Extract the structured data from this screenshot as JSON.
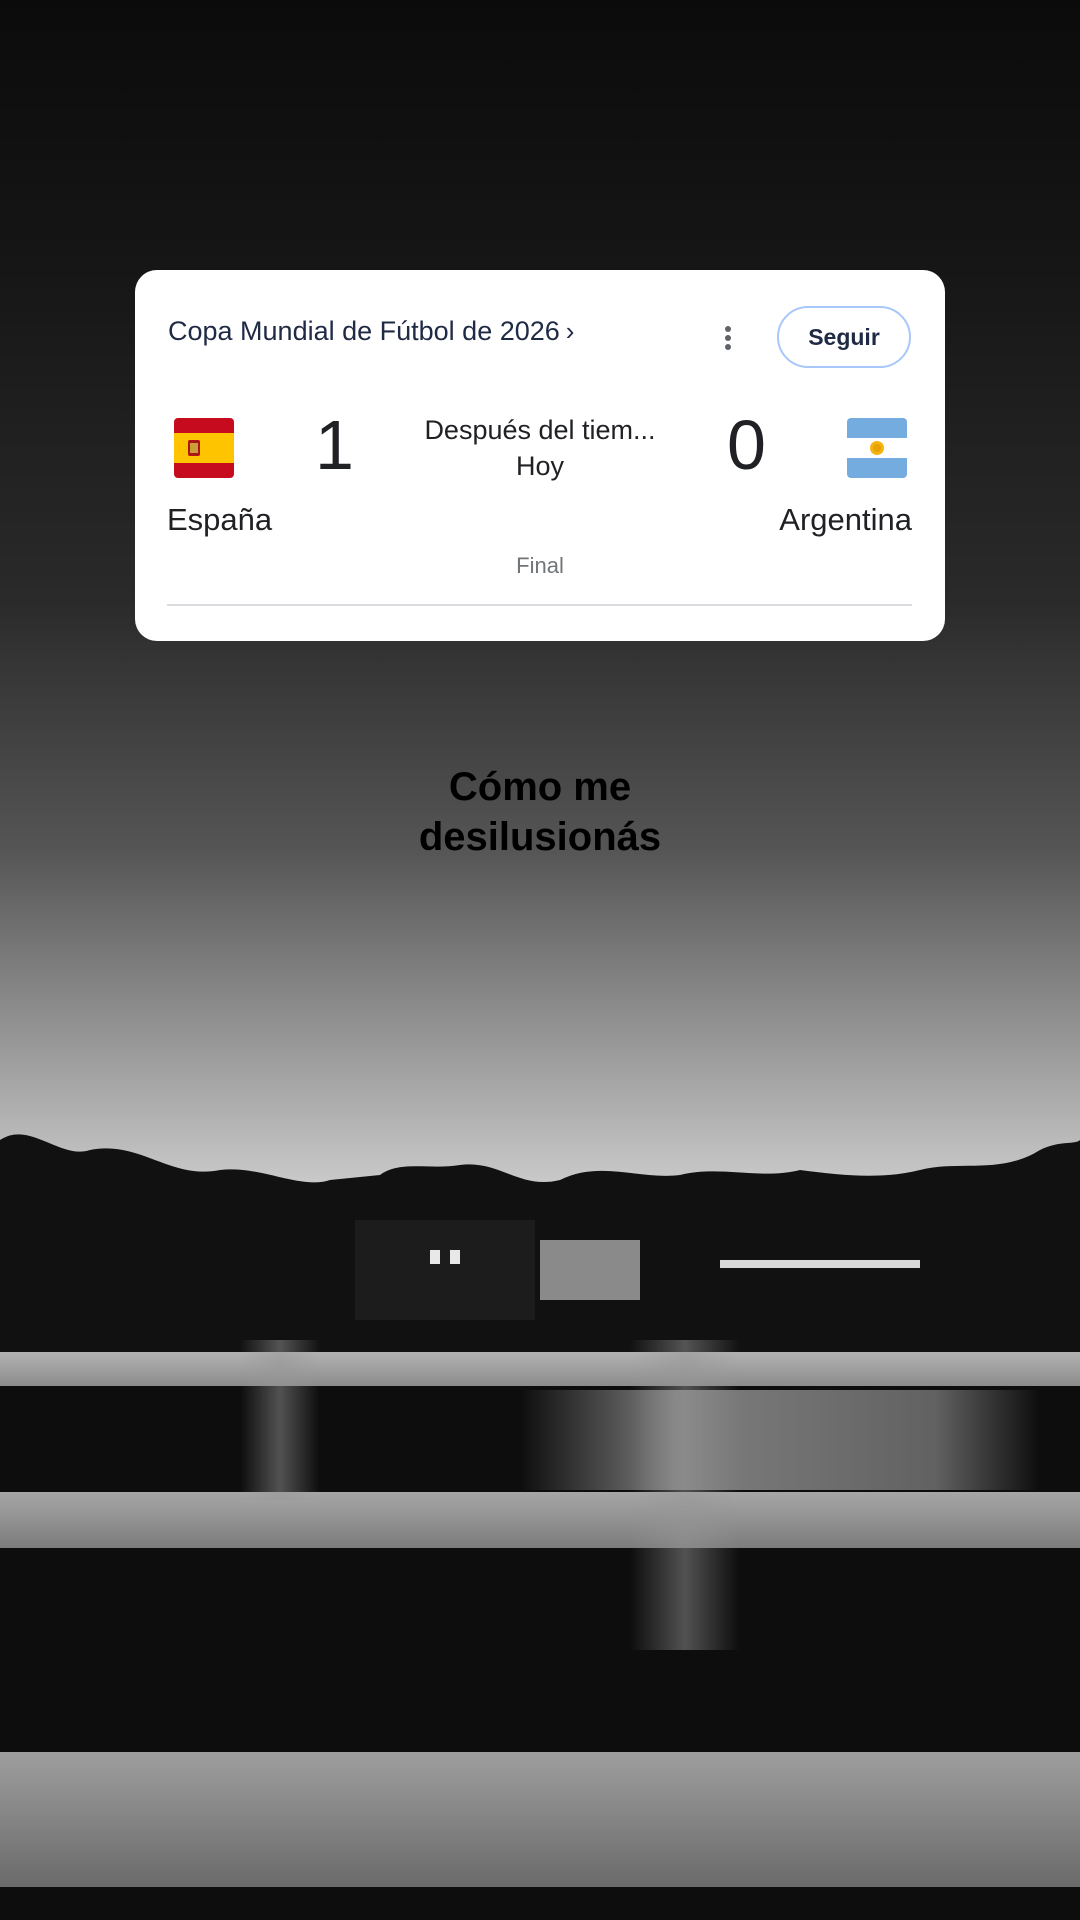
{
  "card": {
    "competition": "Copa Mundial de Fútbol de 2026",
    "competition_chevron": "›",
    "follow_label": "Seguir",
    "home": {
      "name": "España",
      "score": "1",
      "flag": "spain-flag-icon"
    },
    "away": {
      "name": "Argentina",
      "score": "0",
      "flag": "argentina-flag-icon"
    },
    "status_line1": "Después del tiem...",
    "status_line2": "Hoy",
    "final_label": "Final"
  },
  "caption": {
    "line1": "Cómo me",
    "line2": "desilusionás"
  },
  "colors": {
    "card_bg": "#ffffff",
    "follow_border": "#a8c7fa",
    "text_dark": "#202124",
    "text_muted": "#70757a"
  }
}
